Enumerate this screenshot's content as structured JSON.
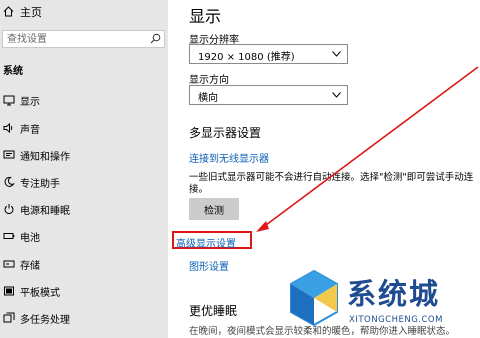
{
  "sidebar": {
    "home_label": "主页",
    "search_placeholder": "查找设置",
    "section_label": "系统",
    "items": [
      {
        "label": "显示",
        "icon": "monitor-icon"
      },
      {
        "label": "声音",
        "icon": "speaker-icon"
      },
      {
        "label": "通知和操作",
        "icon": "notification-icon"
      },
      {
        "label": "专注助手",
        "icon": "moon-icon"
      },
      {
        "label": "电源和睡眠",
        "icon": "power-icon"
      },
      {
        "label": "电池",
        "icon": "battery-icon"
      },
      {
        "label": "存储",
        "icon": "storage-icon"
      },
      {
        "label": "平板模式",
        "icon": "tablet-icon"
      },
      {
        "label": "多任务处理",
        "icon": "multitask-icon"
      }
    ]
  },
  "main": {
    "title": "显示",
    "resolution_label": "显示分辨率",
    "resolution_value": "1920 × 1080 (推荐)",
    "orientation_label": "显示方向",
    "orientation_value": "横向",
    "multi_display_heading": "多显示器设置",
    "wireless_link": "连接到无线显示器",
    "detect_description": "一些旧式显示器可能不会进行自动连接。选择\"检测\"即可尝试手动连接。",
    "detect_button": "检测",
    "advanced_link": "高级显示设置",
    "graphics_link": "图形设置",
    "night_heading": "更优睡眠",
    "night_description": "在晚间，夜间模式会显示较柔和的暖色，帮助你进入睡眠状态。"
  },
  "watermark": {
    "text": "系统城",
    "url": "XITONGCHENG.COM"
  },
  "colors": {
    "accent": "#0b5fb6",
    "highlight": "#e01515",
    "sidebar_bg": "#e6e6e6"
  }
}
